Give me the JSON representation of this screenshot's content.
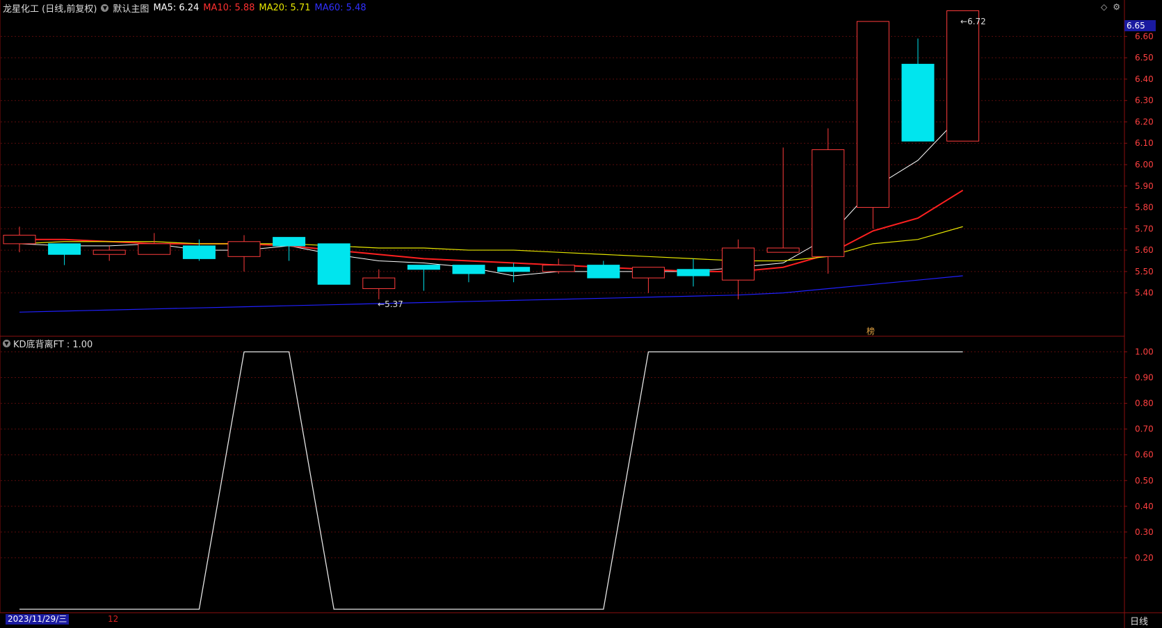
{
  "header": {
    "title": "龙星化工 (日线,前复权)",
    "template": "默认主图",
    "ma5": "MA5: 6.24",
    "ma10": "MA10: 5.88",
    "ma20": "MA20: 5.71",
    "ma60": "MA60: 5.48"
  },
  "indicator_header": {
    "label": "KD底背离FT : 1.00"
  },
  "current_price_tag": "6.65",
  "high_annotation": "6.72",
  "low_annotation": "5.37",
  "marker_char": "榜",
  "footer": {
    "date": "2023/11/29/三",
    "month": "12",
    "period": "日线"
  },
  "colors": {
    "up": "#ff3c3c",
    "down": "#00e5ee",
    "ma5": "#ffffff",
    "ma10": "#ff2020",
    "ma20": "#e6e600",
    "ma60": "#2020ff",
    "axis": "#8b1010"
  },
  "icons": [
    "diamond-icon",
    "settings-icon"
  ],
  "chart_data": [
    {
      "type": "candlestick",
      "title": "龙星化工 (日线,前复权)",
      "ylim": [
        5.22,
        6.74
      ],
      "yticks": [
        "6.60",
        "6.50",
        "6.40",
        "6.30",
        "6.20",
        "6.10",
        "6.00",
        "5.90",
        "5.80",
        "5.70",
        "5.60",
        "5.50",
        "5.40"
      ],
      "candles": [
        {
          "o": 5.63,
          "h": 5.71,
          "l": 5.59,
          "c": 5.67
        },
        {
          "o": 5.63,
          "h": 5.63,
          "l": 5.53,
          "c": 5.58
        },
        {
          "o": 5.58,
          "h": 5.62,
          "l": 5.55,
          "c": 5.6
        },
        {
          "o": 5.58,
          "h": 5.68,
          "l": 5.58,
          "c": 5.63
        },
        {
          "o": 5.62,
          "h": 5.65,
          "l": 5.55,
          "c": 5.56
        },
        {
          "o": 5.57,
          "h": 5.67,
          "l": 5.5,
          "c": 5.64
        },
        {
          "o": 5.66,
          "h": 5.66,
          "l": 5.55,
          "c": 5.62
        },
        {
          "o": 5.63,
          "h": 5.63,
          "l": 5.44,
          "c": 5.44
        },
        {
          "o": 5.42,
          "h": 5.51,
          "l": 5.37,
          "c": 5.47
        },
        {
          "o": 5.53,
          "h": 5.53,
          "l": 5.41,
          "c": 5.51
        },
        {
          "o": 5.53,
          "h": 5.53,
          "l": 5.45,
          "c": 5.49
        },
        {
          "o": 5.52,
          "h": 5.54,
          "l": 5.45,
          "c": 5.5
        },
        {
          "o": 5.5,
          "h": 5.56,
          "l": 5.49,
          "c": 5.53
        },
        {
          "o": 5.53,
          "h": 5.55,
          "l": 5.47,
          "c": 5.47
        },
        {
          "o": 5.47,
          "h": 5.52,
          "l": 5.4,
          "c": 5.52
        },
        {
          "o": 5.51,
          "h": 5.56,
          "l": 5.43,
          "c": 5.48
        },
        {
          "o": 5.46,
          "h": 5.65,
          "l": 5.37,
          "c": 5.61
        },
        {
          "o": 5.59,
          "h": 6.08,
          "l": 5.59,
          "c": 5.61
        },
        {
          "o": 5.57,
          "h": 6.17,
          "l": 5.49,
          "c": 6.07
        },
        {
          "o": 5.8,
          "h": 6.67,
          "l": 5.7,
          "c": 6.67
        },
        {
          "o": 6.47,
          "h": 6.59,
          "l": 6.11,
          "c": 6.11
        },
        {
          "o": 6.11,
          "h": 6.72,
          "l": 6.11,
          "c": 6.72
        }
      ],
      "series": [
        {
          "name": "MA5",
          "values": [
            5.63,
            5.62,
            5.62,
            5.63,
            5.6,
            5.6,
            5.62,
            5.58,
            5.55,
            5.54,
            5.52,
            5.48,
            5.5,
            5.5,
            5.5,
            5.5,
            5.52,
            5.54,
            5.66,
            5.89,
            6.02,
            6.24
          ]
        },
        {
          "name": "MA10",
          "values": [
            5.65,
            5.65,
            5.64,
            5.63,
            5.63,
            5.63,
            5.62,
            5.6,
            5.58,
            5.56,
            5.55,
            5.54,
            5.53,
            5.52,
            5.51,
            5.5,
            5.5,
            5.52,
            5.58,
            5.69,
            5.75,
            5.88
          ]
        },
        {
          "name": "MA20",
          "values": [
            5.63,
            5.64,
            5.64,
            5.64,
            5.63,
            5.63,
            5.63,
            5.62,
            5.61,
            5.61,
            5.6,
            5.6,
            5.59,
            5.58,
            5.57,
            5.56,
            5.55,
            5.55,
            5.57,
            5.63,
            5.65,
            5.71
          ]
        },
        {
          "name": "MA60",
          "values": [
            5.31,
            5.315,
            5.32,
            5.325,
            5.33,
            5.335,
            5.34,
            5.345,
            5.35,
            5.355,
            5.36,
            5.365,
            5.37,
            5.375,
            5.38,
            5.385,
            5.39,
            5.4,
            5.42,
            5.44,
            5.46,
            5.48
          ]
        }
      ]
    },
    {
      "type": "line",
      "title": "KD底背离FT : 1.00",
      "ylim": [
        0,
        1.05
      ],
      "yticks": [
        "1.00",
        "0.90",
        "0.80",
        "0.70",
        "0.60",
        "0.50",
        "0.40",
        "0.30",
        "0.20"
      ],
      "series": [
        {
          "name": "KD底背离FT",
          "values": [
            0,
            0,
            0,
            0,
            0,
            1,
            1,
            0,
            0,
            0,
            0,
            0,
            0,
            0,
            1,
            1,
            1,
            1,
            1,
            1,
            1,
            1
          ]
        }
      ]
    }
  ]
}
